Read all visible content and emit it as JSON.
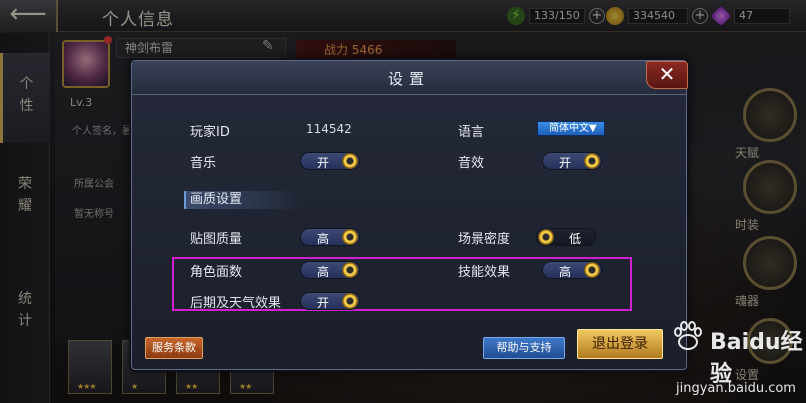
{
  "header": {
    "back_icon": "back-arrow-icon",
    "title": "个人信息",
    "resources": [
      {
        "icon": "energy-icon",
        "value": "133/150",
        "color": "#6ac83a"
      },
      {
        "icon": "gold-coin-icon",
        "value": "334540",
        "color": "#d9a21e"
      },
      {
        "icon": "gem-icon",
        "value": "47",
        "color": "#b04ae0"
      }
    ]
  },
  "left_nav": {
    "tabs": [
      "个\n性",
      "荣\n耀",
      "统\n计"
    ]
  },
  "profile": {
    "name": "神剑布雷",
    "level": "Lv.3",
    "signature": "个人签名，暑",
    "power_label": "战力",
    "power_value": "5466",
    "guild": "所属公会",
    "title": "暂无称号"
  },
  "right_menu": [
    "天赋",
    "时装",
    "魂器",
    "设置"
  ],
  "dialog": {
    "title": "设置",
    "rows": {
      "player_id_label": "玩家ID",
      "player_id_value": "114542",
      "language_label": "语言",
      "language_value": "简体中文▼",
      "music_label": "音乐",
      "music_value": "开",
      "sfx_label": "音效",
      "sfx_value": "开",
      "section_title": "画质设置",
      "texture_label": "贴图质量",
      "texture_value": "高",
      "scene_label": "场景密度",
      "scene_value": "低",
      "face_label": "角色面数",
      "face_value": "高",
      "skill_label": "技能效果",
      "skill_value": "高",
      "post_label": "后期及天气效果",
      "post_value": "开"
    },
    "buttons": {
      "terms": "服务条款",
      "help": "帮助与支持",
      "logout": "退出登录"
    }
  },
  "watermark": {
    "brand": "Baidu经验",
    "url": "jingyan.baidu.com"
  },
  "colors": {
    "highlight_box": "#d11fd1",
    "toggle_on": "#26315a",
    "accent_gold": "#f2c846"
  }
}
